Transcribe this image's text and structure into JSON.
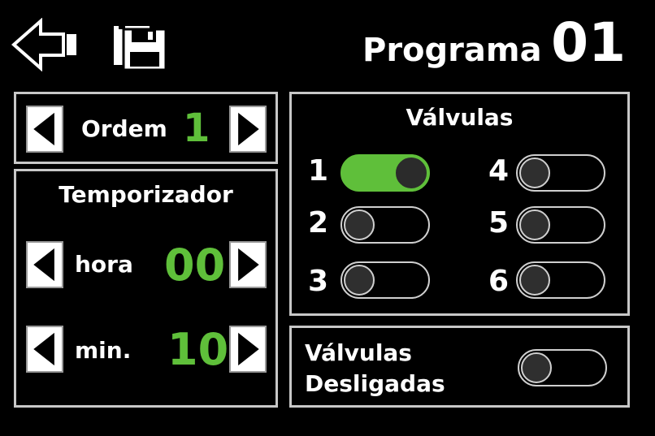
{
  "header": {
    "title_label": "Programa",
    "program_number": "01",
    "back_icon": "back-arrow-icon",
    "save_icon": "save-icon"
  },
  "ordem": {
    "label": "Ordem",
    "value": "1"
  },
  "timer": {
    "title": "Temporizador",
    "hour_label": "hora",
    "hour_value": "00",
    "min_label": "min.",
    "min_value": "10"
  },
  "valves": {
    "title": "Válvulas",
    "items": [
      {
        "label": "1",
        "on": true
      },
      {
        "label": "2",
        "on": false
      },
      {
        "label": "3",
        "on": false
      },
      {
        "label": "4",
        "on": false
      },
      {
        "label": "5",
        "on": false
      },
      {
        "label": "6",
        "on": false
      }
    ]
  },
  "valves_off": {
    "label_line1": "Válvulas",
    "label_line2": "Desligadas",
    "on": false
  },
  "colors": {
    "accent": "#5fbf3a",
    "border": "#c8c8c8",
    "background": "#000000"
  }
}
